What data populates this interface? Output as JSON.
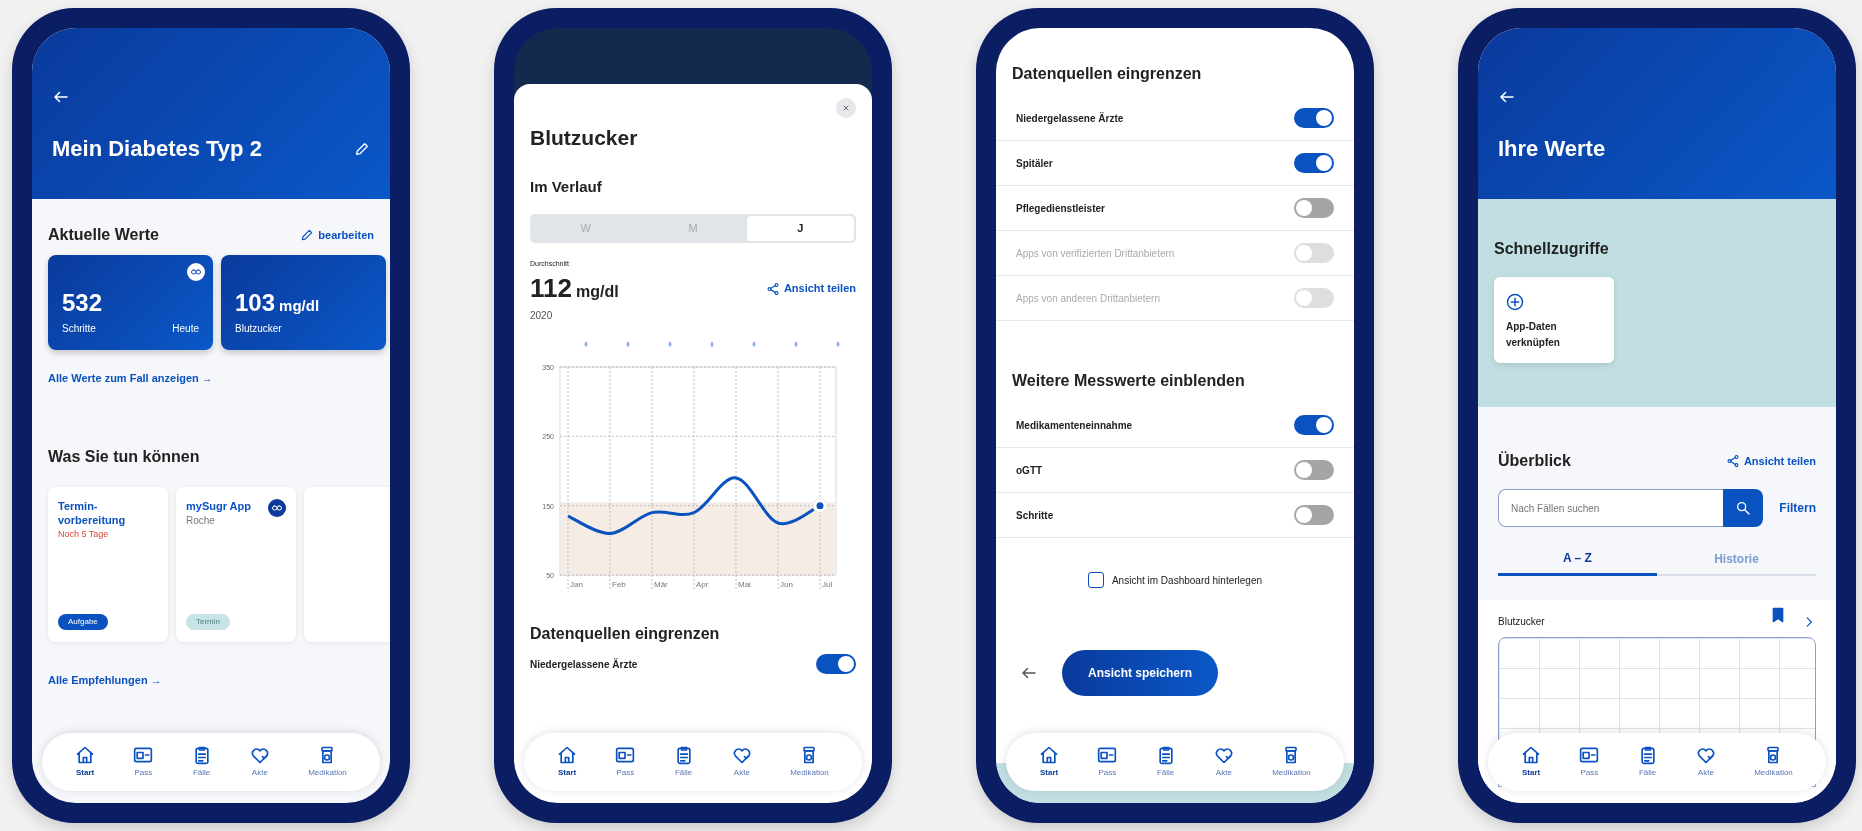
{
  "screens": [
    {
      "kind": "case",
      "title": "Mein Diabetes Typ 2",
      "values_section": {
        "title": "Aktuelle Werte",
        "action": "bearbeiten",
        "link": "Alle Werte zum Fall anzeigen →",
        "tiles": [
          {
            "value": "532",
            "label": "Schritte",
            "meta": "Heute",
            "linked": true
          },
          {
            "value": "103",
            "unit": "mg/dl",
            "label": "Blutzucker",
            "linked": false
          }
        ]
      },
      "actions_section": {
        "title": "Was Sie tun können",
        "link": "Alle Empfehlungen →",
        "cards": [
          {
            "kind": "task",
            "title": "Termin-vorbereitung",
            "subtitle": "Noch 5 Tage",
            "tag": "Aufgabe",
            "linked": false
          },
          {
            "kind": "app",
            "title": "mySugr App",
            "subtitle": "Roche",
            "tag": "Termin",
            "linked": true
          }
        ]
      },
      "nav": [
        {
          "label": "Start",
          "selected": true
        },
        {
          "label": "Pass",
          "selected": false
        },
        {
          "label": "Fälle",
          "selected": false
        },
        {
          "label": "Akte",
          "selected": false
        },
        {
          "label": "Medikation",
          "selected": false
        }
      ]
    },
    {
      "kind": "chart_sheet",
      "title": "Blutzucker",
      "subtitle": "Im Verlauf",
      "periods": [
        {
          "label": "W",
          "selected": false
        },
        {
          "label": "M",
          "selected": false
        },
        {
          "label": "J",
          "selected": true
        }
      ],
      "average_label": "Durchschnitt",
      "average_value": "112",
      "average_unit": "mg/dl",
      "share": "Ansicht teilen",
      "year": "2020",
      "chart_data": {
        "type": "line",
        "categories": [
          "Jan",
          "Feb",
          "Mär",
          "Apr",
          "Mai",
          "Jun",
          "Jul"
        ],
        "ylim": [
          50,
          350
        ],
        "yticks": [
          50,
          150,
          250,
          350
        ],
        "series": [
          {
            "color": "#0a52c0",
            "values": [
              135,
              110,
              140,
              140,
              190,
              125,
              150
            ]
          }
        ]
      },
      "sources_title": "Datenquellen eingrenzen",
      "sources": [
        {
          "label": "Niedergelassene Ärzte",
          "on": true,
          "disabled": false
        }
      ],
      "nav": [
        {
          "label": "Start",
          "selected": true
        },
        {
          "label": "Pass",
          "selected": false
        },
        {
          "label": "Fälle",
          "selected": false
        },
        {
          "label": "Akte",
          "selected": false
        },
        {
          "label": "Medikation",
          "selected": false
        }
      ]
    },
    {
      "kind": "filters",
      "groups": [
        {
          "title": "Datenquellen eingrenzen",
          "toggles": [
            {
              "label": "Niedergelassene Ärzte",
              "on": true,
              "disabled": false
            },
            {
              "label": "Spitäler",
              "on": true,
              "disabled": false
            },
            {
              "label": "Pflegedienstleister",
              "on": false,
              "disabled": false
            },
            {
              "label": "Apps von verifizierten Drittanbietern",
              "on": false,
              "disabled": true
            },
            {
              "label": "Apps von anderen Drittanbietern",
              "on": false,
              "disabled": true
            }
          ]
        },
        {
          "title": "Weitere Messwerte einblenden",
          "toggles": [
            {
              "label": "Medikamenteneinnahme",
              "on": true,
              "disabled": false
            },
            {
              "label": "oGTT",
              "on": false,
              "disabled": false
            },
            {
              "label": "Schritte",
              "on": false,
              "disabled": false
            }
          ]
        }
      ],
      "checkbox": {
        "label": "Ansicht im Dashboard hinterlegen",
        "checked": false
      },
      "save": "Ansicht speichern",
      "nav": [
        {
          "label": "Start",
          "selected": true
        },
        {
          "label": "Pass",
          "selected": false
        },
        {
          "label": "Fälle",
          "selected": false
        },
        {
          "label": "Akte",
          "selected": false
        },
        {
          "label": "Medikation",
          "selected": false
        }
      ]
    },
    {
      "kind": "values",
      "title": "Ihre Werte",
      "quick_title": "Schnellzugriffe",
      "quick_items": [
        {
          "label": "App-Daten verknüpfen"
        }
      ],
      "overview_title": "Überblick",
      "share": "Ansicht teilen",
      "search": {
        "placeholder": "Nach Fällen suchen"
      },
      "filter": "Filtern",
      "tabs": [
        {
          "label": "A – Z",
          "selected": true
        },
        {
          "label": "Historie",
          "selected": false
        }
      ],
      "entries": [
        {
          "title": "Blutzucker",
          "bookmarked": true
        }
      ],
      "nav": [
        {
          "label": "Start",
          "selected": true
        },
        {
          "label": "Pass",
          "selected": false
        },
        {
          "label": "Fälle",
          "selected": false
        },
        {
          "label": "Akte",
          "selected": false
        },
        {
          "label": "Medikation",
          "selected": false
        }
      ]
    }
  ]
}
